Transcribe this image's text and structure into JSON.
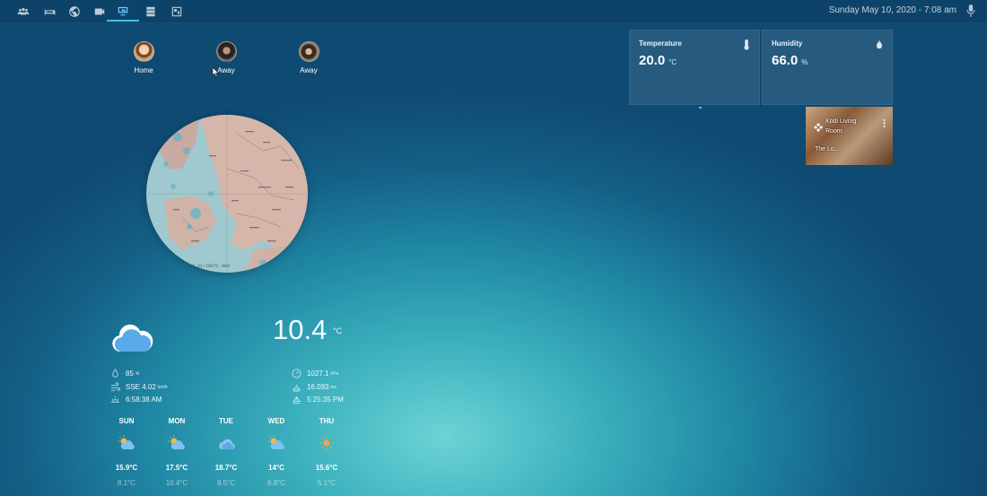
{
  "header": {
    "datetime": "Sunday May 10, 2020 - 7:08 am",
    "tabs": [
      {
        "icon": "people-icon"
      },
      {
        "icon": "bed-icon"
      },
      {
        "icon": "globe-icon"
      },
      {
        "icon": "video-camera-icon"
      },
      {
        "icon": "monitor-icon",
        "active": true
      },
      {
        "icon": "server-icon"
      },
      {
        "icon": "floorplan-icon"
      }
    ]
  },
  "people": [
    {
      "state": "Home"
    },
    {
      "state": "Away"
    },
    {
      "state": "Away"
    }
  ],
  "map": {
    "stamp": "20 21:20UTC 003"
  },
  "sensors": {
    "temperature": {
      "title": "Temperature",
      "value": "20.0",
      "unit": "°C",
      "icon": "thermometer-icon"
    },
    "humidity": {
      "title": "Humidity",
      "value": "66.0",
      "unit": "%",
      "icon": "water-drop-icon"
    }
  },
  "media": {
    "title": "Kodi Living Room",
    "subtitle": "The Lo...",
    "icon": "kodi-icon"
  },
  "weather": {
    "current_temp": "10.4",
    "current_unit": "°C",
    "condition_icon": "cloud-icon",
    "humidity": {
      "value": "85",
      "unit": "%"
    },
    "wind": {
      "value": "SSE 4.02",
      "unit": "km/h"
    },
    "sunrise": "6:58:38 AM",
    "pressure": {
      "value": "1027.1",
      "unit": "hPa"
    },
    "visibility": {
      "value": "16.093",
      "unit": "km"
    },
    "sunset": "5:25:35 PM",
    "forecast": [
      {
        "day": "SUN",
        "high": "15.9°C",
        "low": "8.1°C",
        "icon": "partly-cloudy-icon"
      },
      {
        "day": "MON",
        "high": "17.5°C",
        "low": "10.4°C",
        "icon": "partly-cloudy-icon"
      },
      {
        "day": "TUE",
        "high": "18.7°C",
        "low": "9.5°C",
        "icon": "cloudy-icon"
      },
      {
        "day": "WED",
        "high": "14°C",
        "low": "6.8°C",
        "icon": "partly-cloudy-icon"
      },
      {
        "day": "THU",
        "high": "15.6°C",
        "low": "5.1°C",
        "icon": "sunny-icon"
      }
    ]
  }
}
